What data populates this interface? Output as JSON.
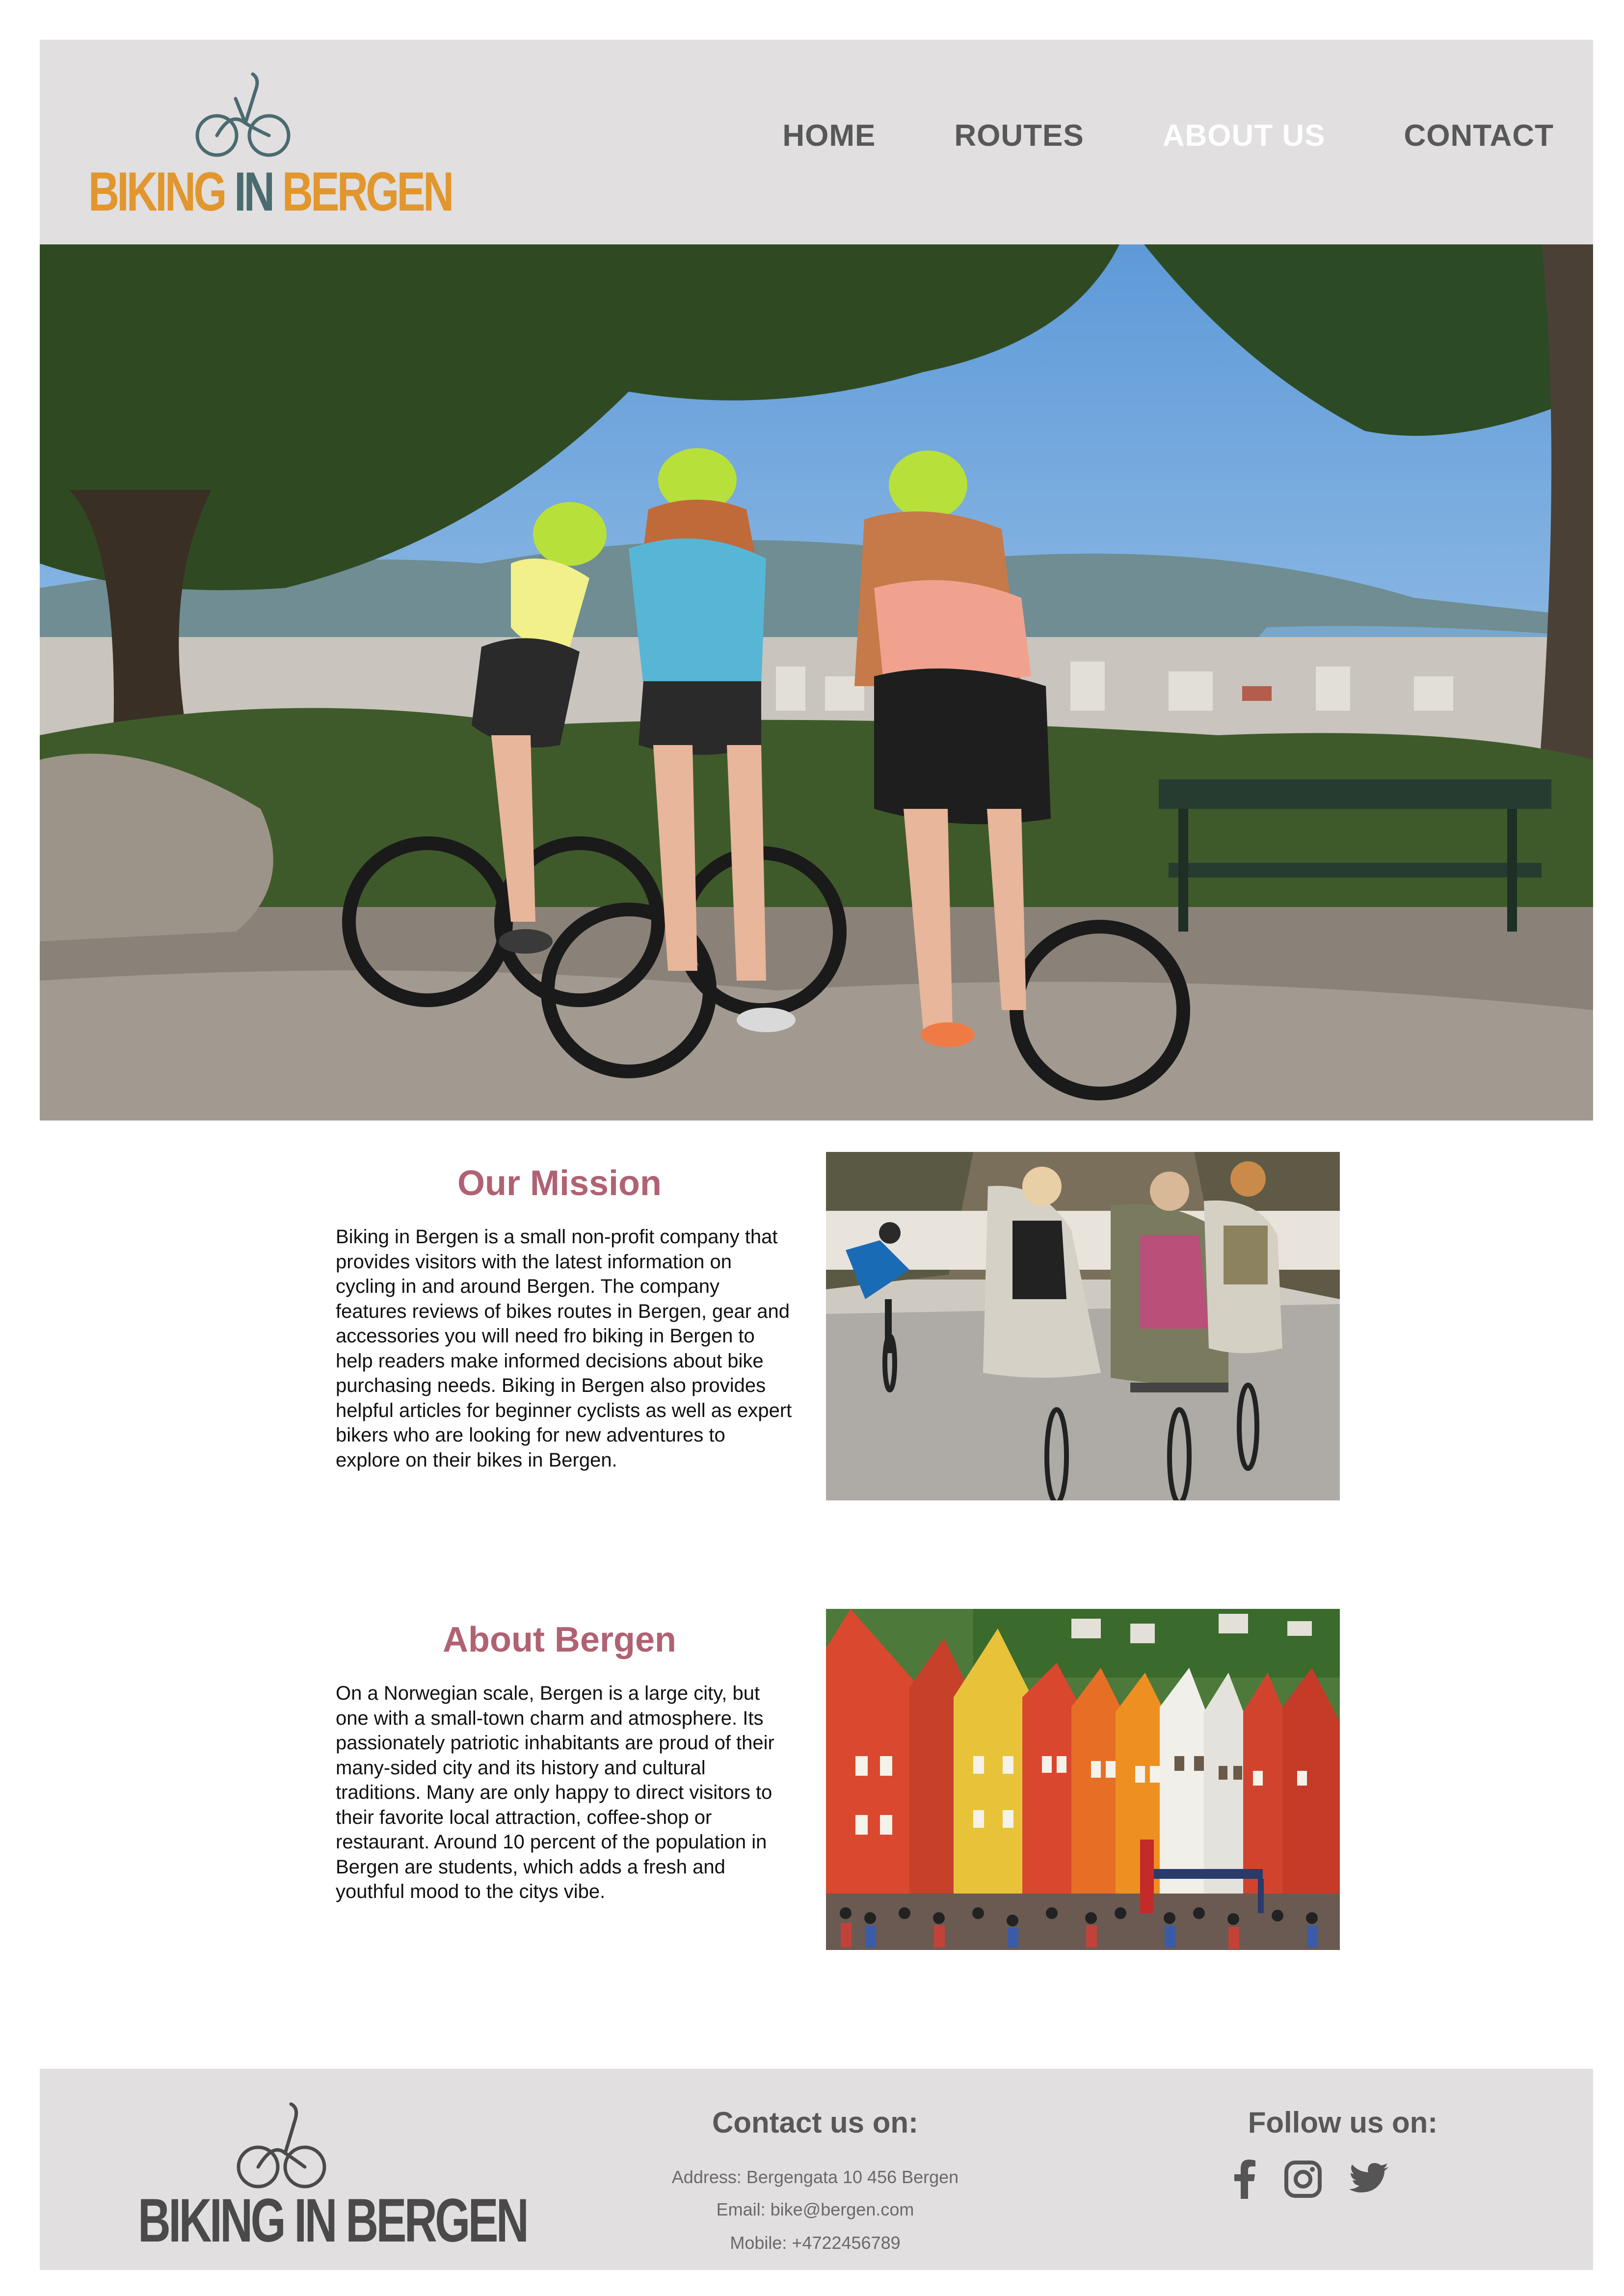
{
  "brand": {
    "logo_text_1": "BIKING",
    "logo_text_2": "IN",
    "logo_text_3": "BERGEN",
    "logo_colors": {
      "primary": "#e1962e",
      "secondary": "#4a6b70"
    }
  },
  "nav": {
    "items": [
      {
        "label": "HOME",
        "active": false
      },
      {
        "label": "ROUTES",
        "active": false
      },
      {
        "label": "ABOUT US",
        "active": true
      },
      {
        "label": "CONTACT",
        "active": false
      }
    ]
  },
  "hero": {
    "image": "three-cyclists-overlooking-bergen-photo"
  },
  "mission": {
    "title": "Our Mission",
    "text": "Biking in Bergen is a small non-profit company that provides visitors with the latest information on cycling in and around Bergen. The company features reviews of bikes routes in Bergen, gear and accessories you will need fro biking in Bergen to help readers make informed decisions about bike purchasing needs. Biking in Bergen also provides helpful articles for beginner cyclists as well as expert bikers who are looking for new adventures to explore on their bikes in Bergen.",
    "image": "cyclists-on-street-photo"
  },
  "about": {
    "title": "About Bergen",
    "text": "On a Norwegian scale, Bergen is a large city, but one with a small-town charm and atmosphere. Its passionately patriotic inhabitants are proud of their many-sided city and its history and cultural traditions. Many are only happy to direct visitors to their favorite local attraction, coffee-shop or restaurant. Around 10 percent of the population in Bergen are students, which adds a fresh and youthful mood to the citys vibe.",
    "image": "bryggen-colorful-houses-photo"
  },
  "footer": {
    "logo_text": "BIKING IN BERGEN",
    "contact_title": "Contact us on:",
    "address": "Address: Bergengata 10 456 Bergen",
    "email": "Email: bike@bergen.com",
    "mobile": "Mobile: +4722456789",
    "follow_title": "Follow us on:",
    "social": [
      "facebook-icon",
      "instagram-icon",
      "twitter-icon"
    ]
  },
  "colors": {
    "header_bg": "#e1dfdf",
    "title_color": "#b06273",
    "nav_text": "#585858",
    "nav_active": "#ffffff"
  }
}
